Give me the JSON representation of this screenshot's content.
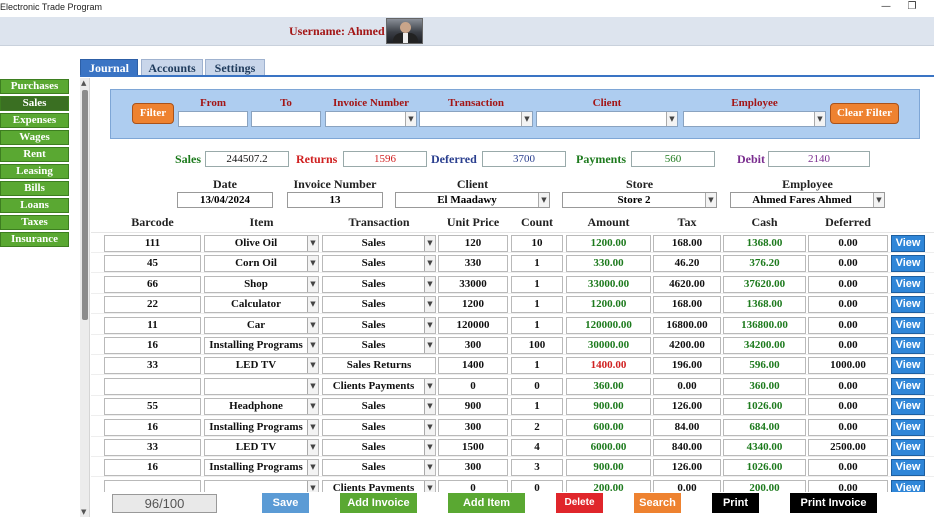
{
  "window": {
    "title": "Electronic Trade Program",
    "minimize": "—",
    "restore": "❐"
  },
  "header": {
    "username": "Username: Ahmed"
  },
  "side_menu": [
    "Purchases",
    "Sales",
    "Expenses",
    "Wages",
    "Rent",
    "Leasing",
    "Bills",
    "Loans",
    "Taxes",
    "Insurance"
  ],
  "tabs": [
    "Journal",
    "Accounts",
    "Settings"
  ],
  "filter": {
    "filter_button": "Filter",
    "clear_button": "Clear Filter",
    "labels": {
      "from": "From",
      "to": "To",
      "invoice_number": "Invoice Number",
      "transaction": "Transaction",
      "client": "Client",
      "employee": "Employee"
    }
  },
  "summary": {
    "sales_label": "Sales",
    "sales_value": "244507.2",
    "returns_label": "Returns",
    "returns_value": "1596",
    "deferred_label": "Deferred",
    "deferred_value": "3700",
    "payments_label": "Payments",
    "payments_value": "560",
    "debit_label": "Debit",
    "debit_value": "2140"
  },
  "invoice": {
    "date_label": "Date",
    "date_value": "13/04/2024",
    "number_label": "Invoice Number",
    "number_value": "13",
    "client_label": "Client",
    "client_value": "El Maadawy",
    "store_label": "Store",
    "store_value": "Store 2",
    "employee_label": "Employee",
    "employee_value": "Ahmed Fares Ahmed"
  },
  "columns": [
    "Barcode",
    "Item",
    "Transaction",
    "Unit Price",
    "Count",
    "Amount",
    "Tax",
    "Cash",
    "Deferred"
  ],
  "view_label": "View",
  "rows": [
    {
      "barcode": "111",
      "item": "Olive Oil",
      "transaction": "Sales",
      "unit_price": "120",
      "count": "10",
      "amount": "1200.00",
      "tax": "168.00",
      "cash": "1368.00",
      "deferred": "0.00",
      "combos": true,
      "amount_color": "green"
    },
    {
      "barcode": "45",
      "item": "Corn Oil",
      "transaction": "Sales",
      "unit_price": "330",
      "count": "1",
      "amount": "330.00",
      "tax": "46.20",
      "cash": "376.20",
      "deferred": "0.00",
      "combos": true,
      "amount_color": "green"
    },
    {
      "barcode": "66",
      "item": "Shop",
      "transaction": "Sales",
      "unit_price": "33000",
      "count": "1",
      "amount": "33000.00",
      "tax": "4620.00",
      "cash": "37620.00",
      "deferred": "0.00",
      "combos": true,
      "amount_color": "green"
    },
    {
      "barcode": "22",
      "item": "Calculator",
      "transaction": "Sales",
      "unit_price": "1200",
      "count": "1",
      "amount": "1200.00",
      "tax": "168.00",
      "cash": "1368.00",
      "deferred": "0.00",
      "combos": true,
      "amount_color": "green"
    },
    {
      "barcode": "11",
      "item": "Car",
      "transaction": "Sales",
      "unit_price": "120000",
      "count": "1",
      "amount": "120000.00",
      "tax": "16800.00",
      "cash": "136800.00",
      "deferred": "0.00",
      "combos": true,
      "amount_color": "green"
    },
    {
      "barcode": "16",
      "item": "Installing Programs",
      "transaction": "Sales",
      "unit_price": "300",
      "count": "100",
      "amount": "30000.00",
      "tax": "4200.00",
      "cash": "34200.00",
      "deferred": "0.00",
      "combos": true,
      "amount_color": "green"
    },
    {
      "barcode": "33",
      "item": "LED TV",
      "transaction": "Sales Returns",
      "unit_price": "1400",
      "count": "1",
      "amount": "1400.00",
      "tax": "196.00",
      "cash": "596.00",
      "deferred": "1000.00",
      "combos": false,
      "amount_color": "red"
    },
    {
      "barcode": "",
      "item": "",
      "transaction": "Clients Payments",
      "unit_price": "0",
      "count": "0",
      "amount": "360.00",
      "tax": "0.00",
      "cash": "360.00",
      "deferred": "0.00",
      "combos": true,
      "amount_color": "green"
    },
    {
      "barcode": "55",
      "item": "Headphone",
      "transaction": "Sales",
      "unit_price": "900",
      "count": "1",
      "amount": "900.00",
      "tax": "126.00",
      "cash": "1026.00",
      "deferred": "0.00",
      "combos": true,
      "amount_color": "green"
    },
    {
      "barcode": "16",
      "item": "Installing Programs",
      "transaction": "Sales",
      "unit_price": "300",
      "count": "2",
      "amount": "600.00",
      "tax": "84.00",
      "cash": "684.00",
      "deferred": "0.00",
      "combos": true,
      "amount_color": "green"
    },
    {
      "barcode": "33",
      "item": "LED TV",
      "transaction": "Sales",
      "unit_price": "1500",
      "count": "4",
      "amount": "6000.00",
      "tax": "840.00",
      "cash": "4340.00",
      "deferred": "2500.00",
      "combos": true,
      "amount_color": "green"
    },
    {
      "barcode": "16",
      "item": "Installing Programs",
      "transaction": "Sales",
      "unit_price": "300",
      "count": "3",
      "amount": "900.00",
      "tax": "126.00",
      "cash": "1026.00",
      "deferred": "0.00",
      "combos": true,
      "amount_color": "green"
    },
    {
      "barcode": "",
      "item": "",
      "transaction": "Clients Payments",
      "unit_price": "0",
      "count": "0",
      "amount": "200.00",
      "tax": "0.00",
      "cash": "200.00",
      "deferred": "0.00",
      "combos": true,
      "amount_color": "green"
    }
  ],
  "bottom": {
    "counter": "96/100",
    "save": "Save",
    "add_invoice": "Add Invoice",
    "add_item": "Add Item",
    "delete": "Delete",
    "search": "Search",
    "print": "Print",
    "print_invoice": "Print Invoice"
  },
  "colors": {
    "menu_green": "#5aa832",
    "tab_blue": "#3a74c4",
    "filter_bg": "#aecdf0",
    "orange": "#ee8230",
    "view_blue": "#2f86d8",
    "label_red": "#a31515",
    "sales_green": "#1d7a1d",
    "deferred_blue": "#2a3f8f",
    "debit_purple": "#7a2d8f"
  },
  "icons": {
    "dropdown": "chevron-down-icon",
    "avatar": "user-photo"
  }
}
